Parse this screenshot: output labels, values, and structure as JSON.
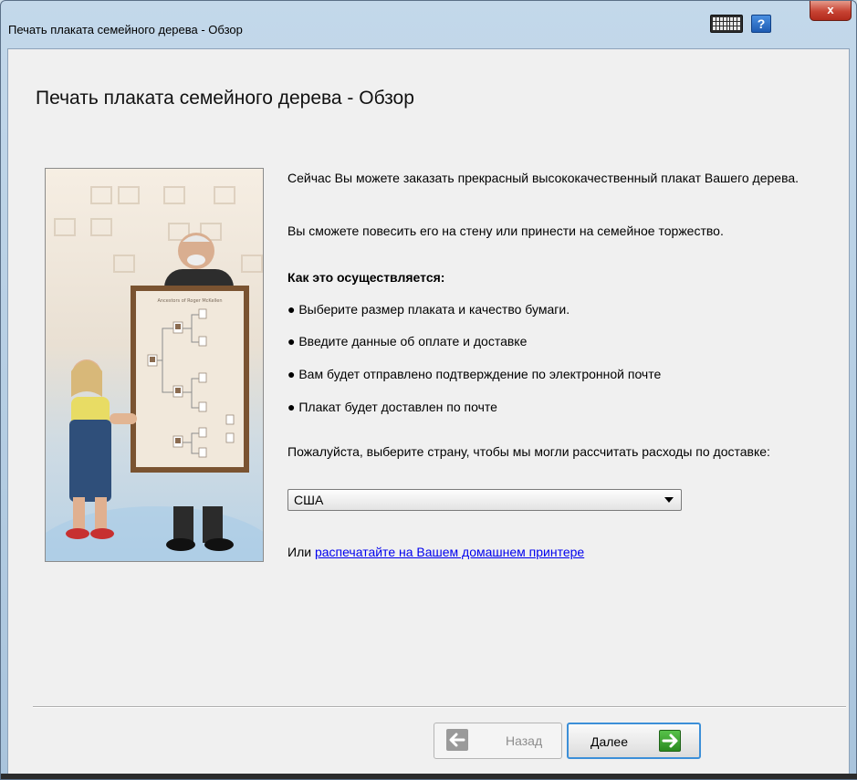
{
  "window": {
    "title": "Печать плаката семейного дерева - Обзор",
    "close_glyph": "x",
    "help_glyph": "?"
  },
  "heading": "Печать плаката семейного дерева - Обзор",
  "intro": {
    "p1": "Сейчас Вы можете заказать прекрасный высококачественный плакат Вашего дерева.",
    "p2": "Вы сможете повесить его на стену или принести на семейное торжество.",
    "how_title": "Как это осуществляется:"
  },
  "steps": [
    "● Выберите размер плаката и качество бумаги.",
    "● Введите данные об оплате и доставке",
    "● Вам будет отправлено подтверждение по электронной почте",
    "● Плакат будет доставлен по почте"
  ],
  "country": {
    "prompt": "Пожалуйста, выберите страну, чтобы мы могли рассчитать расходы по доставке:",
    "selected": "США"
  },
  "home_print": {
    "prefix": "Или ",
    "link": "распечатайте на Вашем домашнем принтере"
  },
  "poster": {
    "title": "Ancestors of Roger McKellen"
  },
  "buttons": {
    "back": "Назад",
    "next": "Далее"
  },
  "icons": {
    "keyboard": "keyboard-icon",
    "help": "help-icon",
    "close": "close-icon",
    "back_arrow": "arrow-left-icon",
    "next_arrow": "arrow-right-icon"
  }
}
